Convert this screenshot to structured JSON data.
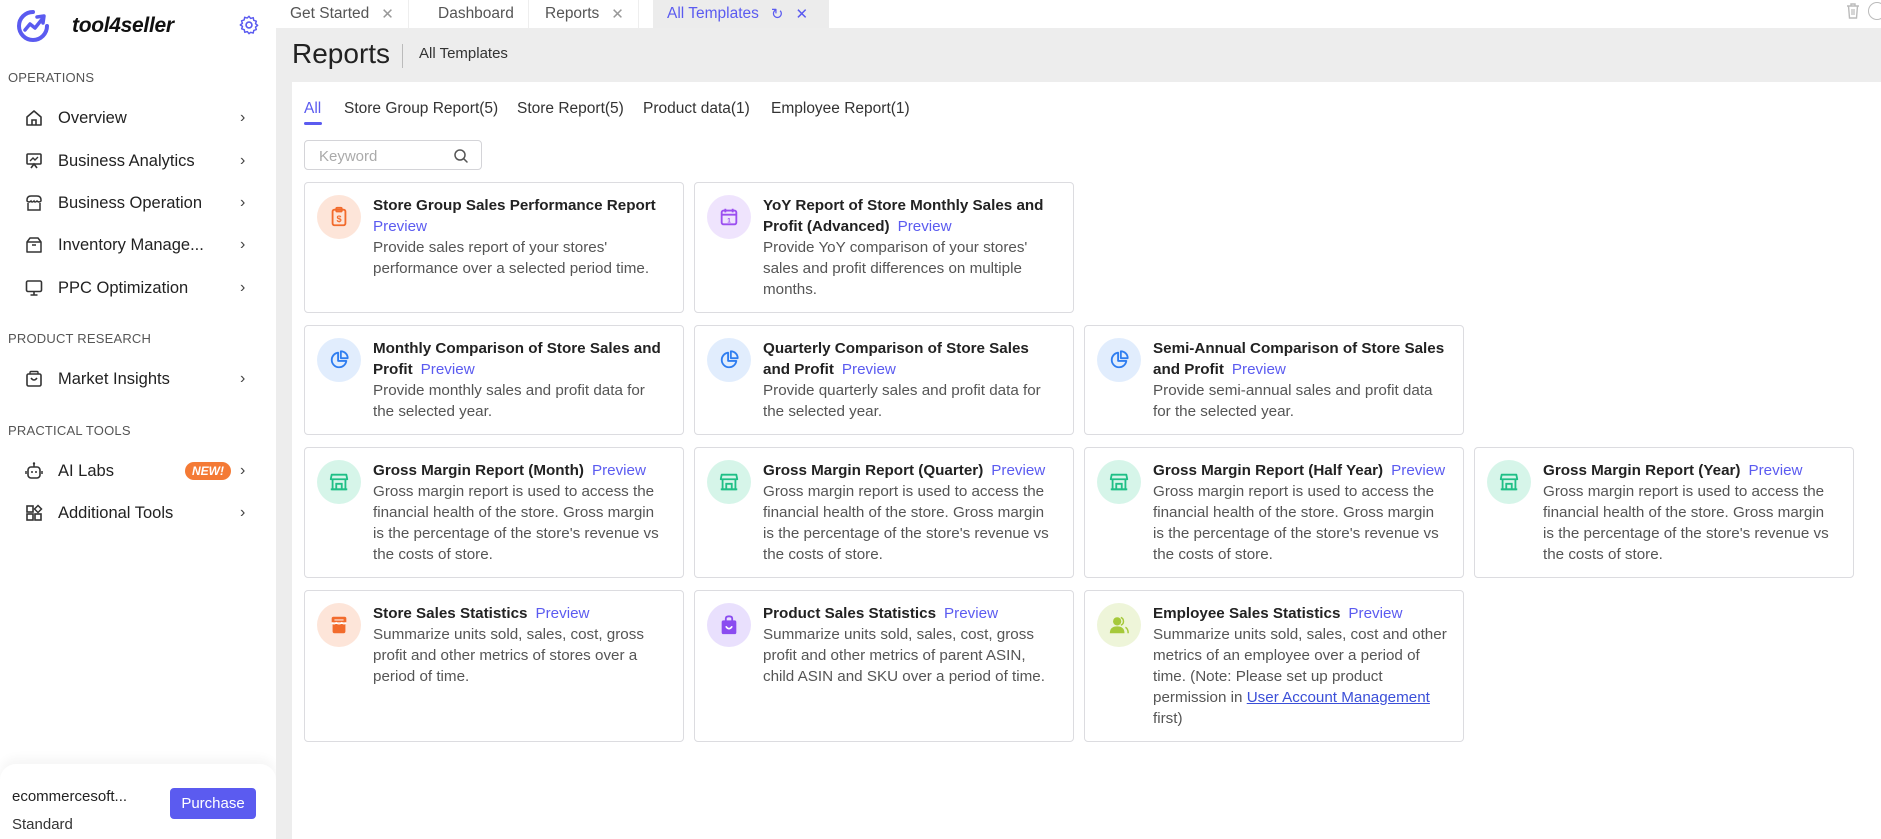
{
  "brand": {
    "name": "tool4seller",
    "accent": "#5b5bf0"
  },
  "sidebar": {
    "sections": [
      {
        "title": "OPERATIONS"
      },
      {
        "title": "PRODUCT RESEARCH"
      },
      {
        "title": "PRACTICAL TOOLS"
      }
    ],
    "items": [
      {
        "label": "Overview",
        "icon": "home-icon"
      },
      {
        "label": "Business Analytics",
        "icon": "presentation-chart-icon"
      },
      {
        "label": "Business Operation",
        "icon": "store-icon"
      },
      {
        "label": "Inventory Manage...",
        "icon": "box-icon"
      },
      {
        "label": "PPC Optimization",
        "icon": "monitor-icon"
      },
      {
        "label": "Market Insights",
        "icon": "shopping-bag-icon"
      },
      {
        "label": "AI Labs",
        "icon": "robot-icon",
        "badge": "NEW!"
      },
      {
        "label": "Additional Tools",
        "icon": "apps-icon"
      }
    ],
    "footer": {
      "account": "ecommercesoft...",
      "plan": "Standard",
      "purchase_label": "Purchase"
    }
  },
  "tabs": [
    {
      "label": "Get Started",
      "closable": true
    },
    {
      "label": "Dashboard",
      "closable": false
    },
    {
      "label": "Reports",
      "closable": true
    },
    {
      "label": "All Templates",
      "closable": true,
      "active": true
    }
  ],
  "header": {
    "title": "Reports",
    "breadcrumb": "All Templates"
  },
  "categories": [
    {
      "label": "All",
      "active": true
    },
    {
      "label": "Store Group Report(5)"
    },
    {
      "label": "Store Report(5)"
    },
    {
      "label": "Product data(1)"
    },
    {
      "label": "Employee Report(1)"
    }
  ],
  "search": {
    "placeholder": "Keyword",
    "value": ""
  },
  "preview_label": "Preview",
  "cards": [
    {
      "title": "Store Group Sales Performance Report",
      "desc": "Provide sales report of your stores' performance over a selected period time.",
      "icon": "clipboard-dollar-icon",
      "icon_color": "#f26b2c",
      "icon_bg": "#fde5d9"
    },
    {
      "title": "YoY Report of Store Monthly Sales and Profit (Advanced)",
      "desc": "Provide YoY comparison of your stores' sales and profit differences on multiple months.",
      "icon": "calendar-icon",
      "icon_color": "#9b4ff0",
      "icon_bg": "#efe4fd"
    },
    {
      "title": "Monthly Comparison of Store Sales and Profit",
      "desc": "Provide monthly sales and profit data for the selected year.",
      "icon": "pie-chart-icon",
      "icon_color": "#2f7ef0",
      "icon_bg": "#e1edfd"
    },
    {
      "title": "Quarterly Comparison of Store Sales and Profit",
      "desc": "Provide quarterly sales and profit data for the selected year.",
      "icon": "pie-chart-icon",
      "icon_color": "#2f7ef0",
      "icon_bg": "#e1edfd"
    },
    {
      "title": "Semi-Annual Comparison of Store Sales and Profit",
      "desc": "Provide semi-annual sales and profit data for the selected year.",
      "icon": "pie-chart-icon",
      "icon_color": "#2f7ef0",
      "icon_bg": "#e1edfd"
    },
    {
      "title": "Gross Margin Report (Month)",
      "desc": "Gross margin report is used to access the financial health of the store. Gross margin is the percentage of the store's revenue vs the costs of store.",
      "icon": "storefront-icon",
      "icon_color": "#1fbf86",
      "icon_bg": "#d6f5e9"
    },
    {
      "title": "Gross Margin Report (Quarter)",
      "desc": "Gross margin report is used to access the financial health of the store. Gross margin is the percentage of the store's revenue vs the costs of store.",
      "icon": "storefront-icon",
      "icon_color": "#1fbf86",
      "icon_bg": "#d6f5e9"
    },
    {
      "title": "Gross Margin Report (Half Year)",
      "desc": "Gross margin report is used to access the financial health of the store. Gross margin is the percentage of the store's revenue vs the costs of store.",
      "icon": "storefront-icon",
      "icon_color": "#1fbf86",
      "icon_bg": "#d6f5e9"
    },
    {
      "title": "Gross Margin Report (Year)",
      "desc": "Gross margin report is used to access the financial health of the store. Gross margin is the percentage of the store's revenue vs the costs of store.",
      "icon": "storefront-icon",
      "icon_color": "#1fbf86",
      "icon_bg": "#d6f5e9"
    },
    {
      "title": "Store Sales Statistics",
      "desc": "Summarize units sold, sales, cost, gross profit and other metrics of stores over a period of time.",
      "icon": "shop-icon",
      "icon_color": "#f26b2c",
      "icon_bg": "#fde5d9"
    },
    {
      "title": "Product Sales Statistics",
      "desc": "Summarize units sold, sales, cost, gross profit and other metrics of parent ASIN, child ASIN and SKU over a period of time.",
      "icon": "shopping-bag-icon",
      "icon_color": "#8a4cf0",
      "icon_bg": "#e9e0fd"
    },
    {
      "title": "Employee Sales Statistics",
      "desc": "Summarize units sold, sales, cost and other metrics of an employee over a period of time. (Note: Please set up product permission in ",
      "link": "User Account Management",
      "desc_after": " first)",
      "icon": "users-icon",
      "icon_color": "#a5c93a",
      "icon_bg": "#eef5d9"
    }
  ]
}
